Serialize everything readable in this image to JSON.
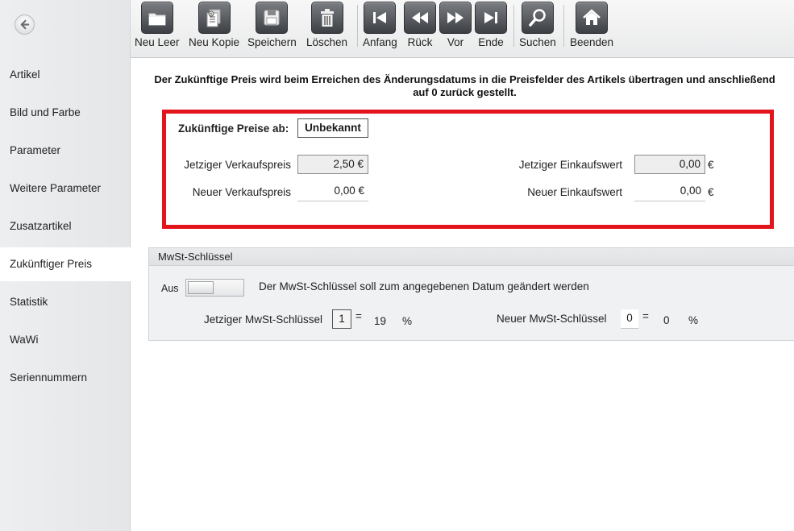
{
  "sidebar": {
    "items": [
      {
        "label": "Artikel"
      },
      {
        "label": "Bild und Farbe"
      },
      {
        "label": "Parameter"
      },
      {
        "label": "Weitere Parameter"
      },
      {
        "label": "Zusatzartikel"
      },
      {
        "label": "Zukünftiger Preis",
        "active": true
      },
      {
        "label": "Statistik"
      },
      {
        "label": "WaWi"
      },
      {
        "label": "Seriennummern"
      }
    ]
  },
  "toolbar": {
    "buttons": [
      {
        "label": "Neu Leer",
        "icon": "folder-icon"
      },
      {
        "label": "Neu Kopie",
        "icon": "copy-document-icon"
      },
      {
        "label": "Speichern",
        "icon": "floppy-disk-icon"
      },
      {
        "label": "Löschen",
        "icon": "trash-icon"
      },
      {
        "label": "Anfang",
        "icon": "first-record-icon"
      },
      {
        "label": "Rück",
        "icon": "previous-icon"
      },
      {
        "label": "Vor",
        "icon": "next-icon"
      },
      {
        "label": "Ende",
        "icon": "last-record-icon"
      },
      {
        "label": "Suchen",
        "icon": "magnifier-icon"
      },
      {
        "label": "Beenden",
        "icon": "home-icon"
      }
    ]
  },
  "info": {
    "line1": "Der Zukünftige Preis wird beim Erreichen des Änderungsdatums in die Preisfelder des Artikels übertragen und anschließend",
    "line2": "auf 0 zurück gestellt."
  },
  "future_price": {
    "from_label": "Zukünftige Preise ab:",
    "from_value": "Unbekannt",
    "current_sale_label": "Jetziger Verkaufspreis",
    "current_sale_value": "2,50 €",
    "new_sale_label": "Neuer Verkaufspreis",
    "new_sale_value": "0,00 €",
    "current_purchase_label": "Jetziger Einkaufswert",
    "current_purchase_value": "0,00",
    "new_purchase_label": "Neuer Einkaufswert",
    "new_purchase_value": "0,00",
    "currency": "€"
  },
  "mwst": {
    "title": "MwSt-Schlüssel",
    "toggle_label": "Aus",
    "description": "Der MwSt-Schlüssel soll zum angegebenen Datum geändert werden",
    "current_label": "Jetziger MwSt-Schlüssel",
    "current_key": "1",
    "current_equals": "=",
    "current_rate": "19",
    "percent": "%",
    "new_label": "Neuer MwSt-Schlüssel",
    "new_key": "0",
    "new_equals": "=",
    "new_rate": "0"
  },
  "colors": {
    "highlight_border": "#e3141b",
    "sidebar_bg": "#e8eaec",
    "toolbar_icon": "#4a4d51"
  }
}
